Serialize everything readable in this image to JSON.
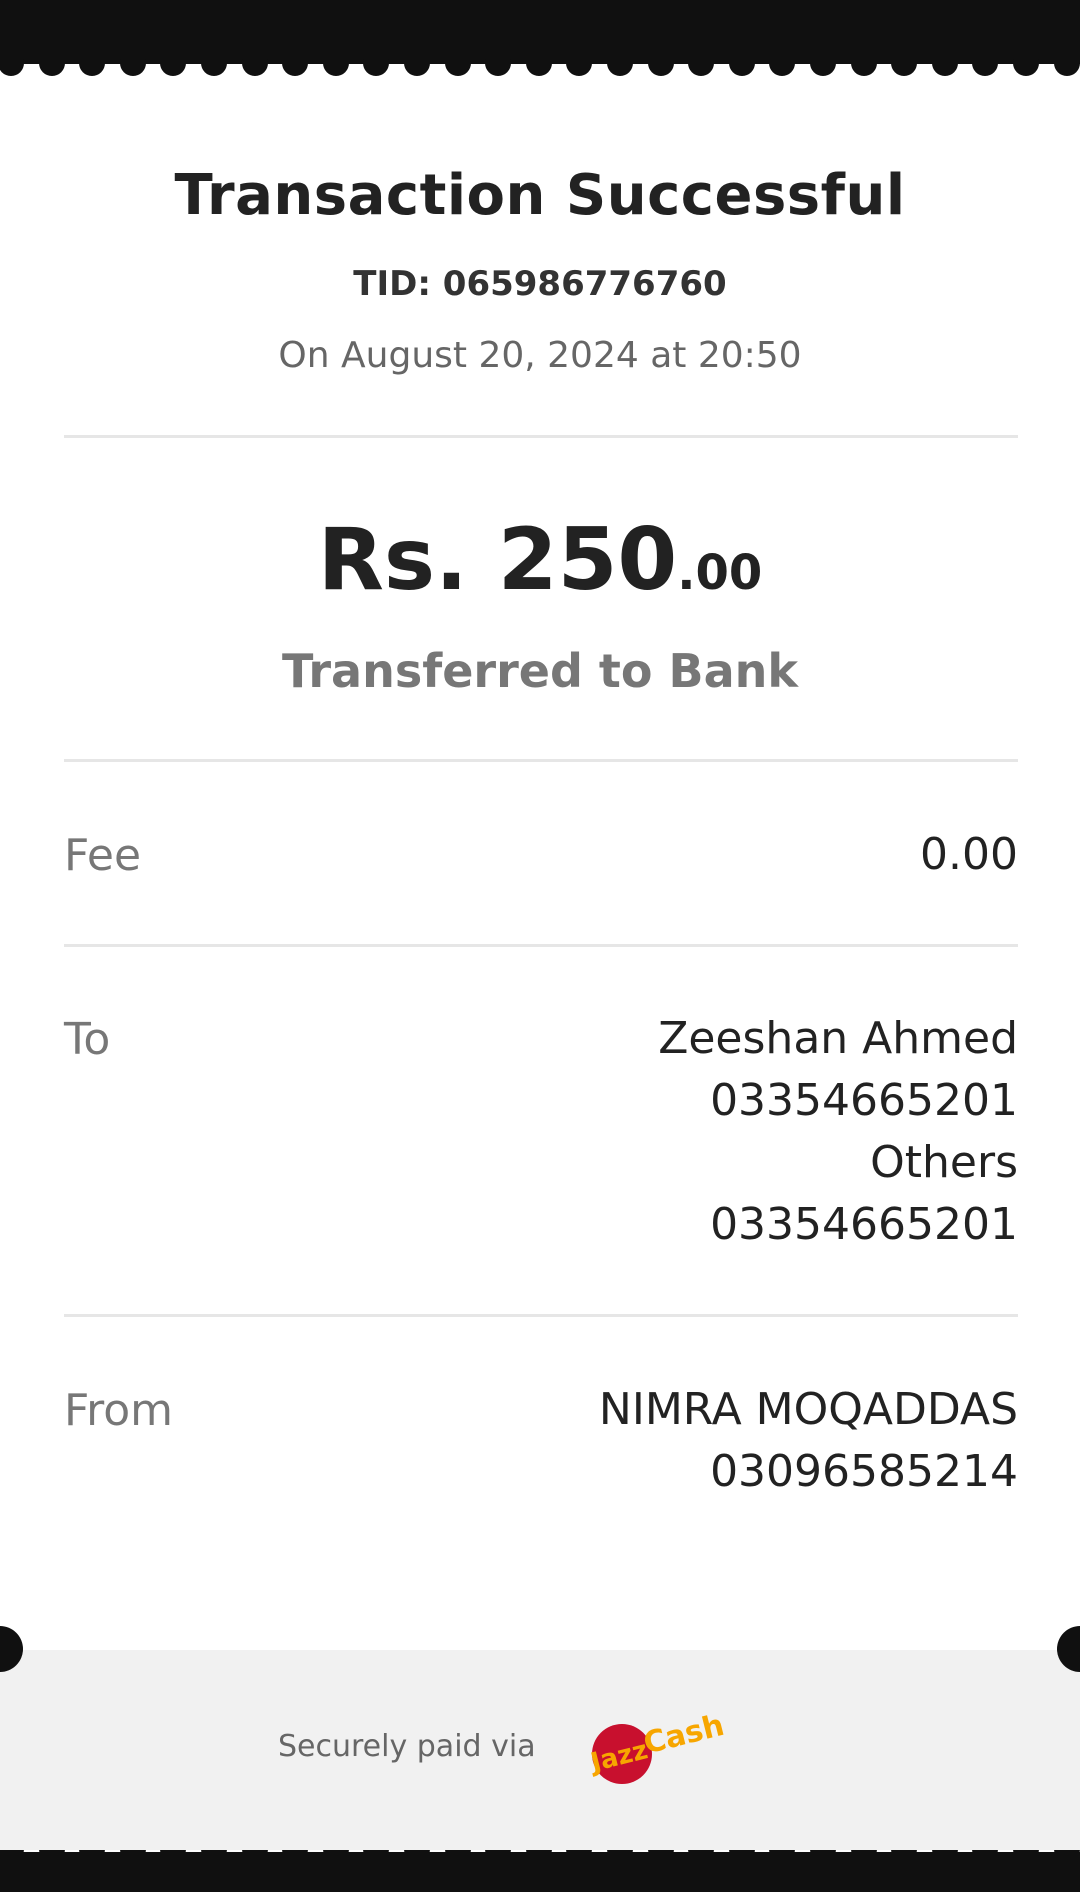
{
  "receipt": {
    "title": "Transaction Successful",
    "tid": "TID: 065986776760",
    "date": "On August 20, 2024 at 20:50",
    "amount_main": "Rs. 250",
    "amount_cents": ".00",
    "transfer_type": "Transferred to Bank"
  },
  "rows": {
    "fee": {
      "label": "Fee",
      "value": "0.00"
    },
    "to": {
      "label": "To",
      "name": "Zeeshan Ahmed",
      "number": "03354665201",
      "bank": "Others",
      "account": "03354665201"
    },
    "from": {
      "label": "From",
      "name": "NIMRA MOQADDAS",
      "number": "03096585214"
    }
  },
  "footer": {
    "text": "Securely paid via",
    "logo_text": "JazzCash",
    "logo_colors": {
      "red": "#c8102e",
      "orange": "#f7a600"
    }
  }
}
